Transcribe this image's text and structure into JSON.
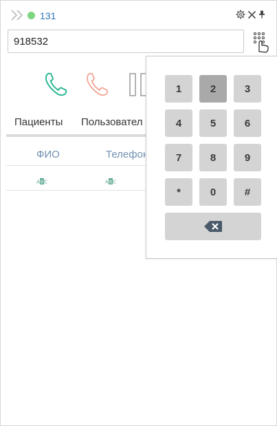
{
  "header": {
    "extension": "131",
    "status_color": "#7ed67e"
  },
  "input": {
    "value": "918532"
  },
  "tabs": [
    {
      "label": "Пациенты"
    },
    {
      "label": "Пользовател"
    }
  ],
  "table": {
    "columns": [
      "ФИО",
      "Телефон"
    ]
  },
  "dialpad": {
    "keys": [
      "1",
      "2",
      "3",
      "4",
      "5",
      "6",
      "7",
      "8",
      "9",
      "*",
      "0",
      "#"
    ],
    "pressed_key": "2"
  },
  "colors": {
    "accent_blue": "#2e73b8",
    "call_green": "#2fb894",
    "hangup_red": "#f0a090",
    "key_bg": "#d4d4d4",
    "key_pressed_bg": "#a9a9a9"
  }
}
